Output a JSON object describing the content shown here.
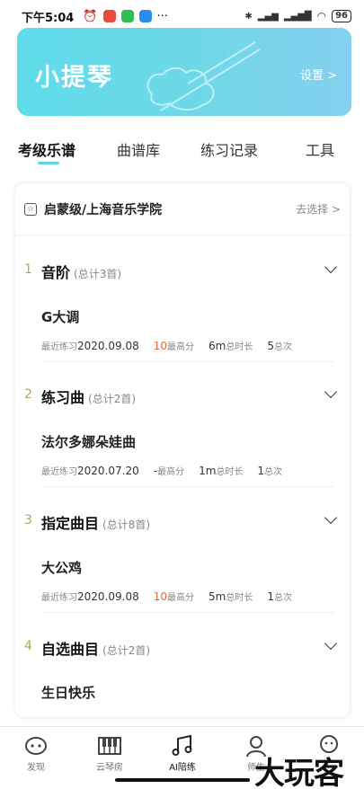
{
  "status_bar": {
    "time": "下午5:04",
    "battery": "96",
    "more": "···"
  },
  "banner": {
    "title": "小提琴",
    "settings_label": "设置 >"
  },
  "tabs": [
    {
      "label": "考级乐谱",
      "active": true
    },
    {
      "label": "曲谱库",
      "active": false
    },
    {
      "label": "练习记录",
      "active": false
    },
    {
      "label": "工具",
      "active": false
    }
  ],
  "card": {
    "level": "启蒙级/上海音乐学院",
    "choose_label": "去选择 >",
    "sections": [
      {
        "num": "1",
        "title": "音阶",
        "count": "(总计3首)",
        "song": {
          "name": "G大调",
          "last_label": "最近练习",
          "last_date": "2020.09.08",
          "score": "10",
          "score_label": "最高分",
          "duration": "6m",
          "duration_label": "总时长",
          "times": "5",
          "times_label": "总次"
        }
      },
      {
        "num": "2",
        "title": "练习曲",
        "count": "(总计2首)",
        "song": {
          "name": "法尔多娜朵娃曲",
          "last_label": "最近练习",
          "last_date": "2020.07.20",
          "score": "-",
          "score_label": "最高分",
          "duration": "1m",
          "duration_label": "总时长",
          "times": "1",
          "times_label": "总次"
        }
      },
      {
        "num": "3",
        "title": "指定曲目",
        "count": "(总计8首)",
        "song": {
          "name": "大公鸡",
          "last_label": "最近练习",
          "last_date": "2020.09.08",
          "score": "10",
          "score_label": "最高分",
          "duration": "5m",
          "duration_label": "总时长",
          "times": "1",
          "times_label": "总次"
        }
      },
      {
        "num": "4",
        "title": "自选曲目",
        "count": "(总计2首)",
        "song": {
          "name": "生日快乐"
        }
      }
    ]
  },
  "bottom_nav": [
    {
      "label": "发现",
      "icon": "discover-icon"
    },
    {
      "label": "云琴房",
      "icon": "piano-icon"
    },
    {
      "label": "AI陪练",
      "icon": "music-note-icon",
      "active": true
    },
    {
      "label": "师生",
      "icon": "teacher-icon"
    },
    {
      "label": "",
      "icon": "profile-icon"
    }
  ],
  "watermark": "大玩客",
  "colors": {
    "accent": "#5fd6e6",
    "highlight": "#e2673f",
    "section_num": "#b9a25a"
  }
}
